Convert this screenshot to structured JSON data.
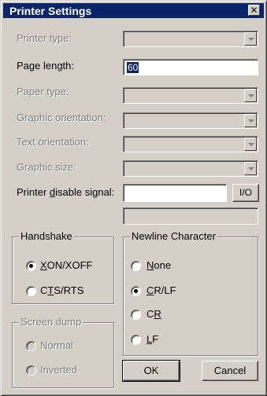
{
  "window": {
    "title": "Printer Settings"
  },
  "fields": {
    "printer_type": "Printer type:",
    "page_length": "Page length:",
    "page_length_value": "60",
    "paper_type": "Paper type:",
    "graphic_orientation": "Graphic orientation:",
    "text_orientation": "Text orientation:",
    "graphic_size": "Graphic size:",
    "printer_disable_signal_pre": "Printer ",
    "printer_disable_signal_key": "d",
    "printer_disable_signal_post": "isable signal:",
    "io_button": "I/O"
  },
  "handshake": {
    "title": "Handshake",
    "xon_key": "X",
    "xon_rest": "ON/XOFF",
    "cts_pre": "C",
    "cts_key": "T",
    "cts_rest": "S/RTS",
    "selected": "XON/XOFF"
  },
  "screen_dump": {
    "title": "Screen dump",
    "normal": "Normal",
    "inverted": "Inverted"
  },
  "newline": {
    "title": "Newline Character",
    "none_key": "N",
    "none_rest": "one",
    "crlf_key": "C",
    "crlf_rest": "R/LF",
    "cr_pre": "C",
    "cr_key": "R",
    "lf_key": "L",
    "lf_rest": "F",
    "selected": "CR/LF"
  },
  "buttons": {
    "ok": "OK",
    "cancel": "Cancel"
  }
}
